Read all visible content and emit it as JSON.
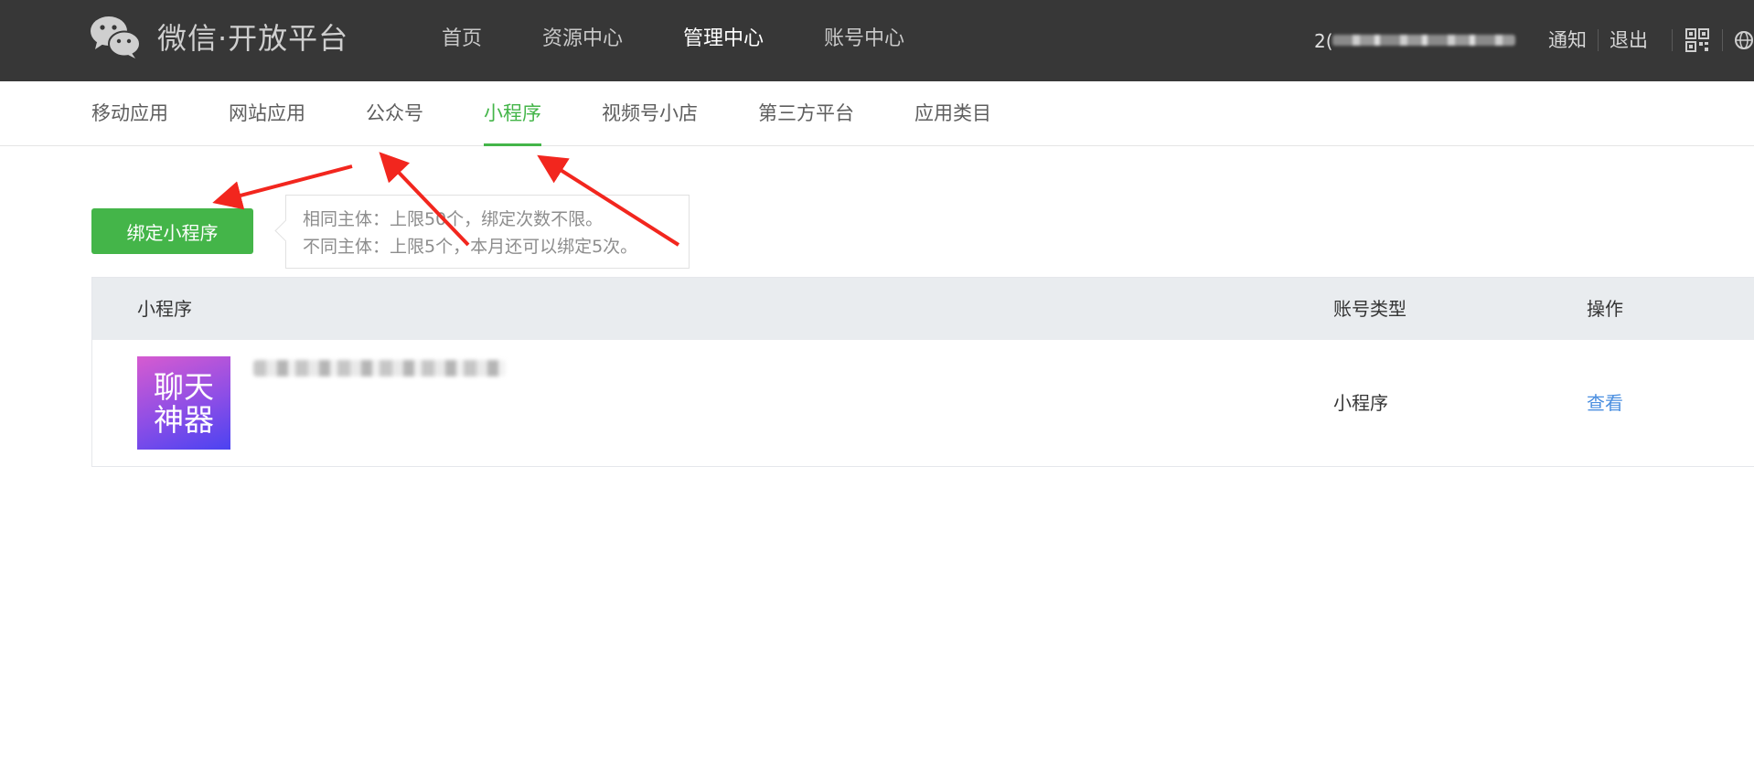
{
  "header": {
    "logo_text": "微信·开放平台",
    "nav": [
      {
        "label": "首页",
        "active": false
      },
      {
        "label": "资源中心",
        "active": false
      },
      {
        "label": "管理中心",
        "active": true
      },
      {
        "label": "账号中心",
        "active": false
      }
    ],
    "account_prefix": "2(",
    "links": {
      "notify": "通知",
      "logout": "退出"
    }
  },
  "subnav": [
    {
      "label": "移动应用",
      "active": false
    },
    {
      "label": "网站应用",
      "active": false
    },
    {
      "label": "公众号",
      "active": false
    },
    {
      "label": "小程序",
      "active": true
    },
    {
      "label": "视频号小店",
      "active": false
    },
    {
      "label": "第三方平台",
      "active": false
    },
    {
      "label": "应用类目",
      "active": false
    }
  ],
  "bind_button": "绑定小程序",
  "tip": {
    "line1": "相同主体：上限50个，绑定次数不限。",
    "line2": "不同主体：上限5个，本月还可以绑定5次。"
  },
  "table": {
    "headers": {
      "name": "小程序",
      "type": "账号类型",
      "action": "操作"
    },
    "rows": [
      {
        "logo_line1": "聊天",
        "logo_line2": "神器",
        "type": "小程序",
        "action": "查看"
      }
    ]
  },
  "colors": {
    "topbar": "#373737",
    "accent_green": "#44b549",
    "link_blue": "#4b8fe0",
    "arrow_red": "#f2261e"
  },
  "icons": [
    "wechat-logo-icon",
    "qr-code-icon",
    "globe-icon"
  ]
}
